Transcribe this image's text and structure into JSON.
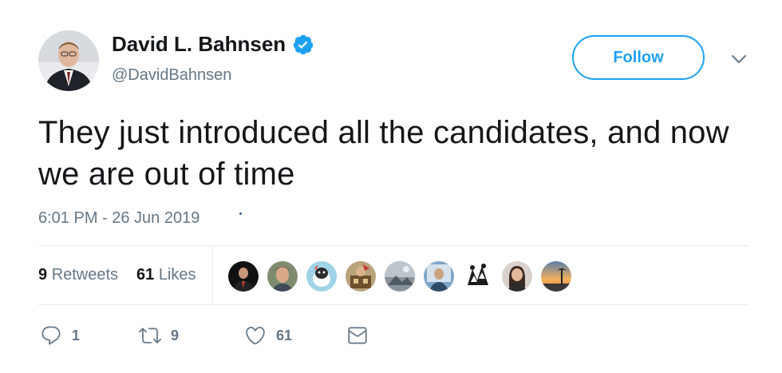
{
  "author": {
    "display_name": "David L. Bahnsen",
    "handle": "@DavidBahnsen",
    "verified": true,
    "avatar_icon": "profile-photo"
  },
  "header": {
    "follow_label": "Follow",
    "menu_icon": "chevron-down-icon"
  },
  "tweet": {
    "text": "They just introduced all the candidates, and now we are out of time",
    "timestamp": "6:01 PM - 26 Jun 2019"
  },
  "stats": {
    "retweets_count": "9",
    "retweets_label": "Retweets",
    "likes_count": "61",
    "likes_label": "Likes",
    "liker_avatars_count": 9
  },
  "actions": {
    "reply_count": "1",
    "retweet_count": "9",
    "like_count": "61"
  },
  "colors": {
    "accent": "#1da1f2",
    "text": "#14171a",
    "muted": "#657786",
    "divider": "#e6ecf0"
  }
}
